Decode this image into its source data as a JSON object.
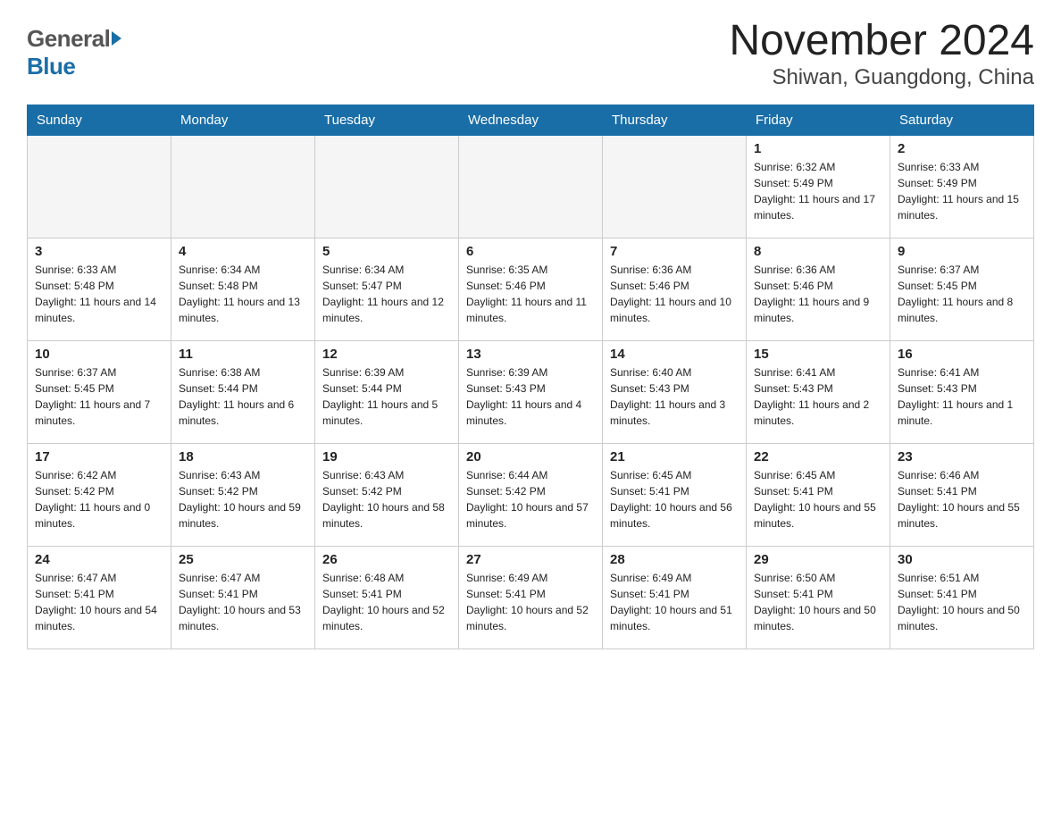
{
  "header": {
    "logo_line1": "General",
    "logo_line2": "Blue",
    "month_title": "November 2024",
    "location": "Shiwan, Guangdong, China"
  },
  "days_of_week": [
    "Sunday",
    "Monday",
    "Tuesday",
    "Wednesday",
    "Thursday",
    "Friday",
    "Saturday"
  ],
  "weeks": [
    [
      {
        "day": "",
        "info": ""
      },
      {
        "day": "",
        "info": ""
      },
      {
        "day": "",
        "info": ""
      },
      {
        "day": "",
        "info": ""
      },
      {
        "day": "",
        "info": ""
      },
      {
        "day": "1",
        "info": "Sunrise: 6:32 AM\nSunset: 5:49 PM\nDaylight: 11 hours and 17 minutes."
      },
      {
        "day": "2",
        "info": "Sunrise: 6:33 AM\nSunset: 5:49 PM\nDaylight: 11 hours and 15 minutes."
      }
    ],
    [
      {
        "day": "3",
        "info": "Sunrise: 6:33 AM\nSunset: 5:48 PM\nDaylight: 11 hours and 14 minutes."
      },
      {
        "day": "4",
        "info": "Sunrise: 6:34 AM\nSunset: 5:48 PM\nDaylight: 11 hours and 13 minutes."
      },
      {
        "day": "5",
        "info": "Sunrise: 6:34 AM\nSunset: 5:47 PM\nDaylight: 11 hours and 12 minutes."
      },
      {
        "day": "6",
        "info": "Sunrise: 6:35 AM\nSunset: 5:46 PM\nDaylight: 11 hours and 11 minutes."
      },
      {
        "day": "7",
        "info": "Sunrise: 6:36 AM\nSunset: 5:46 PM\nDaylight: 11 hours and 10 minutes."
      },
      {
        "day": "8",
        "info": "Sunrise: 6:36 AM\nSunset: 5:46 PM\nDaylight: 11 hours and 9 minutes."
      },
      {
        "day": "9",
        "info": "Sunrise: 6:37 AM\nSunset: 5:45 PM\nDaylight: 11 hours and 8 minutes."
      }
    ],
    [
      {
        "day": "10",
        "info": "Sunrise: 6:37 AM\nSunset: 5:45 PM\nDaylight: 11 hours and 7 minutes."
      },
      {
        "day": "11",
        "info": "Sunrise: 6:38 AM\nSunset: 5:44 PM\nDaylight: 11 hours and 6 minutes."
      },
      {
        "day": "12",
        "info": "Sunrise: 6:39 AM\nSunset: 5:44 PM\nDaylight: 11 hours and 5 minutes."
      },
      {
        "day": "13",
        "info": "Sunrise: 6:39 AM\nSunset: 5:43 PM\nDaylight: 11 hours and 4 minutes."
      },
      {
        "day": "14",
        "info": "Sunrise: 6:40 AM\nSunset: 5:43 PM\nDaylight: 11 hours and 3 minutes."
      },
      {
        "day": "15",
        "info": "Sunrise: 6:41 AM\nSunset: 5:43 PM\nDaylight: 11 hours and 2 minutes."
      },
      {
        "day": "16",
        "info": "Sunrise: 6:41 AM\nSunset: 5:43 PM\nDaylight: 11 hours and 1 minute."
      }
    ],
    [
      {
        "day": "17",
        "info": "Sunrise: 6:42 AM\nSunset: 5:42 PM\nDaylight: 11 hours and 0 minutes."
      },
      {
        "day": "18",
        "info": "Sunrise: 6:43 AM\nSunset: 5:42 PM\nDaylight: 10 hours and 59 minutes."
      },
      {
        "day": "19",
        "info": "Sunrise: 6:43 AM\nSunset: 5:42 PM\nDaylight: 10 hours and 58 minutes."
      },
      {
        "day": "20",
        "info": "Sunrise: 6:44 AM\nSunset: 5:42 PM\nDaylight: 10 hours and 57 minutes."
      },
      {
        "day": "21",
        "info": "Sunrise: 6:45 AM\nSunset: 5:41 PM\nDaylight: 10 hours and 56 minutes."
      },
      {
        "day": "22",
        "info": "Sunrise: 6:45 AM\nSunset: 5:41 PM\nDaylight: 10 hours and 55 minutes."
      },
      {
        "day": "23",
        "info": "Sunrise: 6:46 AM\nSunset: 5:41 PM\nDaylight: 10 hours and 55 minutes."
      }
    ],
    [
      {
        "day": "24",
        "info": "Sunrise: 6:47 AM\nSunset: 5:41 PM\nDaylight: 10 hours and 54 minutes."
      },
      {
        "day": "25",
        "info": "Sunrise: 6:47 AM\nSunset: 5:41 PM\nDaylight: 10 hours and 53 minutes."
      },
      {
        "day": "26",
        "info": "Sunrise: 6:48 AM\nSunset: 5:41 PM\nDaylight: 10 hours and 52 minutes."
      },
      {
        "day": "27",
        "info": "Sunrise: 6:49 AM\nSunset: 5:41 PM\nDaylight: 10 hours and 52 minutes."
      },
      {
        "day": "28",
        "info": "Sunrise: 6:49 AM\nSunset: 5:41 PM\nDaylight: 10 hours and 51 minutes."
      },
      {
        "day": "29",
        "info": "Sunrise: 6:50 AM\nSunset: 5:41 PM\nDaylight: 10 hours and 50 minutes."
      },
      {
        "day": "30",
        "info": "Sunrise: 6:51 AM\nSunset: 5:41 PM\nDaylight: 10 hours and 50 minutes."
      }
    ]
  ]
}
